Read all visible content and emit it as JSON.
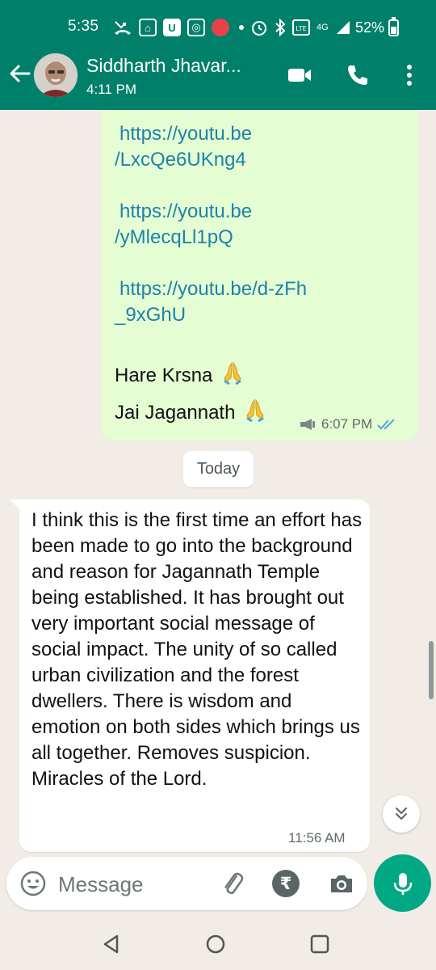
{
  "status_bar": {
    "time": "5:35",
    "battery": "52%",
    "network": "4G"
  },
  "header": {
    "contact_name": "Siddharth Jhavar...",
    "subtitle": "4:11 PM"
  },
  "messages": {
    "outgoing": {
      "link_1_line_1": "https://youtu.be",
      "link_1_line_2": "/LxcQe6UKng4",
      "link_2_line_1": "https://youtu.be",
      "link_2_line_2": "/yMlecqLl1pQ",
      "link_3_line_1": "https://youtu.be/d-zFh",
      "link_3_line_2": "_9xGhU",
      "line_hare": "Hare Krsna",
      "line_jai": "Jai Jagannath",
      "time": "6:07 PM"
    },
    "date_divider": "Today",
    "incoming": {
      "text": "I think this is the first time an effort has been made to go into the background and reason for Jagannath Temple being established. It has brought out very important social message of social impact. The unity of so called urban civilization and the forest dwellers. There is wisdom and  emotion on both sides which brings us all together. Removes suspicion. Miracles of the Lord.",
      "time": "11:56 AM"
    }
  },
  "composer": {
    "placeholder": "Message",
    "rupee_symbol": "₹"
  },
  "icons": {
    "back": "arrow-left",
    "video": "video-camera",
    "call": "phone",
    "menu": "more-vertical",
    "emoji": "smiley",
    "attach": "paperclip",
    "payment": "rupee",
    "camera": "camera",
    "mic": "microphone",
    "scroll": "double-chevron-down"
  },
  "colors": {
    "header": "#00806a",
    "outgoing_bubble": "#e4fdd3",
    "link": "#1f82a8",
    "mic_button": "#00a884",
    "read_ticks": "#4fa8d8"
  }
}
